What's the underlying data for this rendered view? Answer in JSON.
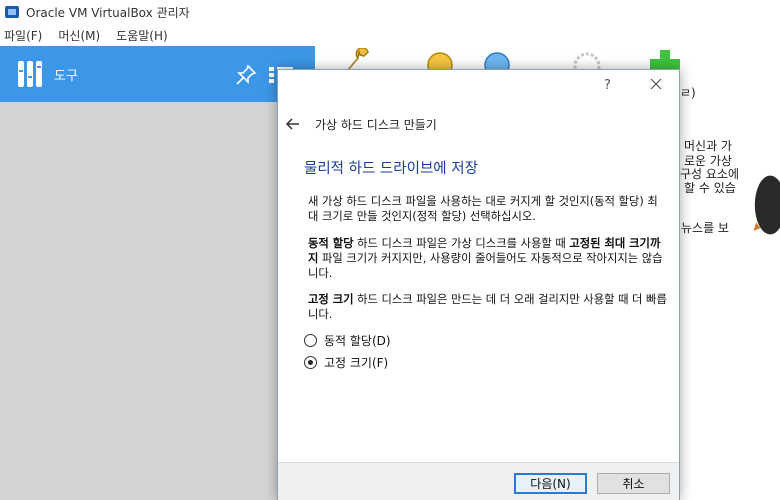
{
  "window": {
    "title": "Oracle VM VirtualBox 관리자"
  },
  "menubar": {
    "items": [
      "파일(F)",
      "머신(M)",
      "도움말(H)"
    ]
  },
  "left_pane": {
    "tools_label": "도구"
  },
  "right_pane": {
    "fragments": [
      "ㄹ)",
      "머신과 가",
      "로운 가상",
      "구성 요소에",
      "할 수 있습",
      "뉴스를 보"
    ]
  },
  "dialog": {
    "help": "?",
    "header_title": "가상 하드 디스크 만들기",
    "heading": "물리적 하드 드라이브에 저장",
    "para1": "새 가상 하드 디스크 파일을 사용하는 대로 커지게 할 것인지(동적 할당) 최대 크기로 만들 것인지(정적 할당) 선택하십시오.",
    "para2_bold1": "동적 할당",
    "para2_mid": " 하드 디스크 파일은 가상 디스크를 사용할 때 ",
    "para2_bold2": "고정된 최대 크기까지",
    "para2_end": " 파일 크기가 커지지만, 사용량이 줄어들어도 자동적으로 작아지지는 않습니다.",
    "para3_bold": "고정 크기",
    "para3_end": " 하드 디스크 파일은 만드는 데 더 오래 걸리지만 사용할 때 더 빠릅니다.",
    "options": [
      {
        "label": "동적 할당(D)",
        "checked": false
      },
      {
        "label": "고정 크기(F)",
        "checked": true
      }
    ],
    "buttons": {
      "next": "다음(N)",
      "cancel": "취소"
    }
  },
  "colors": {
    "accent": "#3d97e8",
    "heading": "#1a3c9c",
    "left_bg": "#d4d4d4"
  }
}
